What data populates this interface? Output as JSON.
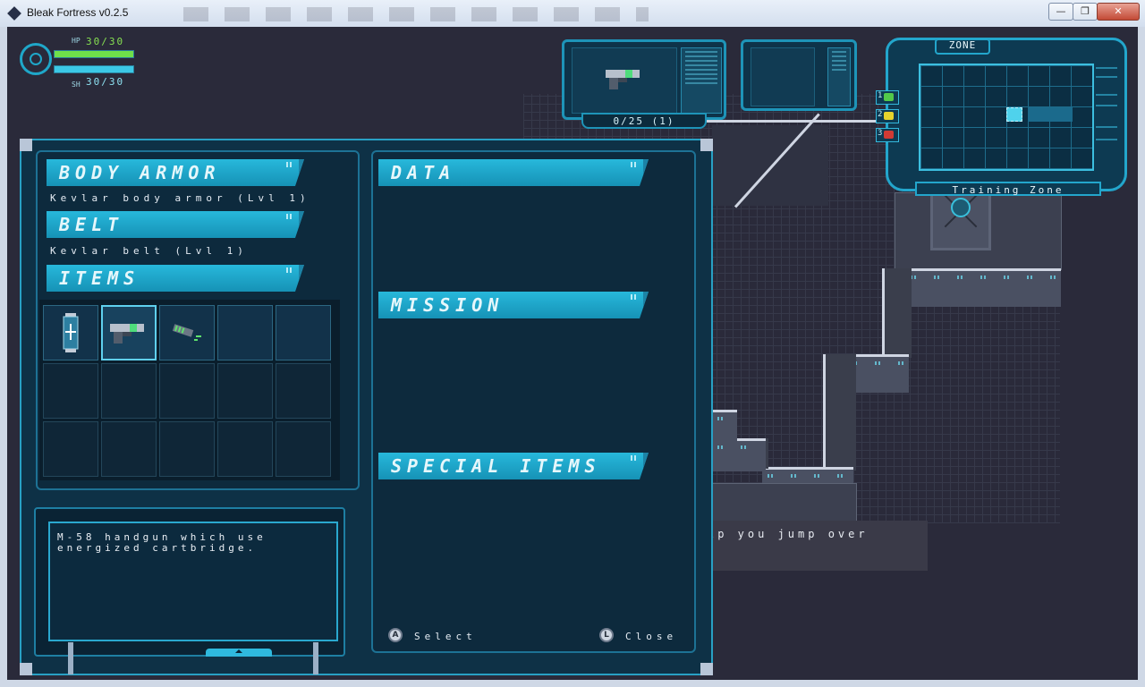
{
  "window": {
    "title": "Bleak Fortress v0.2.5",
    "min_label": "—",
    "max_label": "❐",
    "close_label": "✕"
  },
  "hud": {
    "hp_label": "HP",
    "hp_value": "30/30",
    "hp_fraction": 1.0,
    "sh_label": "SH",
    "sh_value": "30/30",
    "sh_fraction": 1.0,
    "hp_color": "#6fe04a",
    "sh_color": "#3cc8e6"
  },
  "weapon": {
    "primary_icon": "handgun-icon",
    "ammo": "0/25 (1)",
    "secondary_icon": "empty-slot"
  },
  "minimap": {
    "title": "ZONE",
    "zone_name": "Training Zone",
    "keys": [
      {
        "num": "1",
        "color": "#52c94a"
      },
      {
        "num": "2",
        "color": "#e6d42c"
      },
      {
        "num": "3",
        "color": "#d23a34"
      }
    ]
  },
  "background_message": "lp you jump over",
  "inventory": {
    "body_armor": {
      "heading": "BODY ARMOR",
      "value": "Kevlar body armor (Lvl 1)"
    },
    "belt": {
      "heading": "BELT",
      "value": "Kevlar belt (Lvl 1)"
    },
    "items": {
      "heading": "ITEMS",
      "slots": [
        {
          "icon": "health-canister-icon"
        },
        {
          "icon": "handgun-icon",
          "selected": true
        },
        {
          "icon": "energy-cartridge-icon"
        },
        {
          "icon": ""
        },
        {
          "icon": ""
        },
        {
          "icon": ""
        },
        {
          "icon": ""
        },
        {
          "icon": ""
        },
        {
          "icon": ""
        },
        {
          "icon": ""
        },
        {
          "icon": ""
        },
        {
          "icon": ""
        },
        {
          "icon": ""
        },
        {
          "icon": ""
        },
        {
          "icon": ""
        }
      ]
    },
    "description": "M-58 handgun which use energized cartbridge.",
    "data_heading": "DATA",
    "mission_heading": "MISSION",
    "special_heading": "SPECIAL ITEMS",
    "select_button_glyph": "A",
    "select_label": "Select",
    "close_button_glyph": "L",
    "close_label": "Close"
  }
}
